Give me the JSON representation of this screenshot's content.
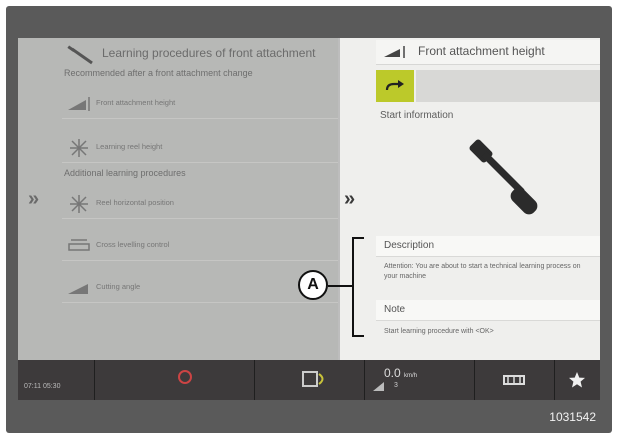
{
  "left_panel": {
    "title": "Learning procedures of front attachment",
    "section_recommended": "Recommended after a front attachment change",
    "section_additional": "Additional learning procedures",
    "items": [
      {
        "label": "Front attachment height",
        "icon": "attachment-height-icon"
      },
      {
        "label": "Learning reel height",
        "icon": "reel-icon"
      },
      {
        "label": "Reel horizontal position",
        "icon": "reel-horizontal-icon"
      },
      {
        "label": "Cross levelling control",
        "icon": "cross-levelling-icon"
      },
      {
        "label": "Cutting angle",
        "icon": "cutting-angle-icon"
      }
    ],
    "expand_chevron": "»"
  },
  "right_panel": {
    "header": "Front attachment height",
    "start_button_icon": "arrow-right-icon",
    "start_info_label": "Start information",
    "description_label": "Description",
    "description_text": "Attention: You are about to start a technical learning process on your machine",
    "note_label": "Note",
    "note_text": "Start learning procedure with <OK>",
    "chevron": "»"
  },
  "status_bar": {
    "time": "07:11   05:30",
    "speed_value": "0.0",
    "speed_unit": "km/h",
    "gear": "3"
  },
  "callout": {
    "label": "A"
  },
  "figure_code": "1031542",
  "colors": {
    "accent_green": "#bcc92a"
  }
}
